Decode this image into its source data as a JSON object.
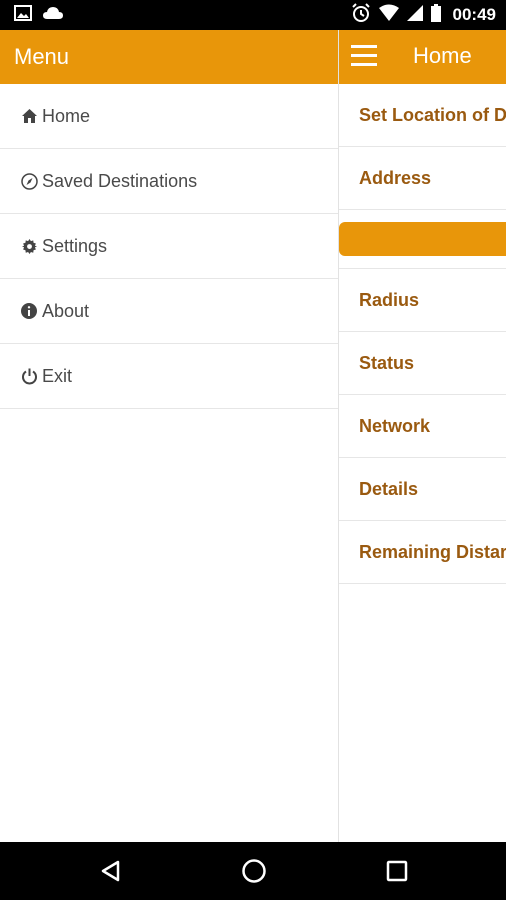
{
  "status_bar": {
    "time": "00:49",
    "left_icons": [
      "image-icon",
      "cloud-icon"
    ],
    "right_icons": [
      "alarm-icon",
      "wifi-icon",
      "signal-icon",
      "battery-icon"
    ]
  },
  "drawer": {
    "title": "Menu",
    "items": [
      {
        "icon": "home-icon",
        "label": "Home"
      },
      {
        "icon": "compass-icon",
        "label": "Saved Destinations"
      },
      {
        "icon": "gear-icon",
        "label": "Settings"
      },
      {
        "icon": "info-icon",
        "label": "About"
      },
      {
        "icon": "power-icon",
        "label": "Exit"
      }
    ]
  },
  "main": {
    "title": "Home",
    "rows": {
      "set_location": "Set Location of D",
      "address": "Address",
      "radius": "Radius",
      "status": "Status",
      "network": "Network",
      "details": "Details",
      "remaining": "Remaining Distar"
    }
  },
  "colors": {
    "accent": "#e8960a",
    "label_brown": "#9a5a10",
    "status_bar": "#000000"
  },
  "nav_bar": {
    "icons": [
      "back-icon",
      "home-circle-icon",
      "recents-icon"
    ]
  }
}
